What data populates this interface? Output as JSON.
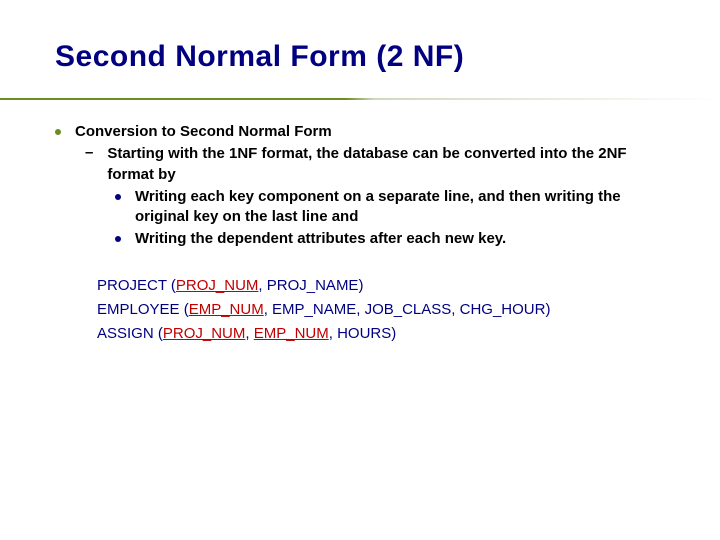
{
  "title": "Second Normal Form (2 NF)",
  "bullets": {
    "l1": "Conversion to Second Normal Form",
    "l2": "Starting with the 1NF format, the database can be converted into the 2NF format by",
    "l3a": "Writing each key component on a separate line, and then writing the original key on the last line and",
    "l3b": "Writing the dependent attributes after each new key."
  },
  "schema": {
    "project": {
      "name": "PROJECT",
      "key1": "PROJ_NUM",
      "rest": ", PROJ_NAME)"
    },
    "employee": {
      "name": "EMPLOYEE",
      "key1": "EMP_NUM",
      "rest": ", EMP_NAME, JOB_CLASS, CHG_HOUR)"
    },
    "assign": {
      "name": "ASSIGN",
      "key1": "PROJ_NUM",
      "key2": "EMP_NUM",
      "rest": ", HOURS)"
    }
  },
  "punct": {
    "open": " (",
    "comma_sp": ", "
  }
}
